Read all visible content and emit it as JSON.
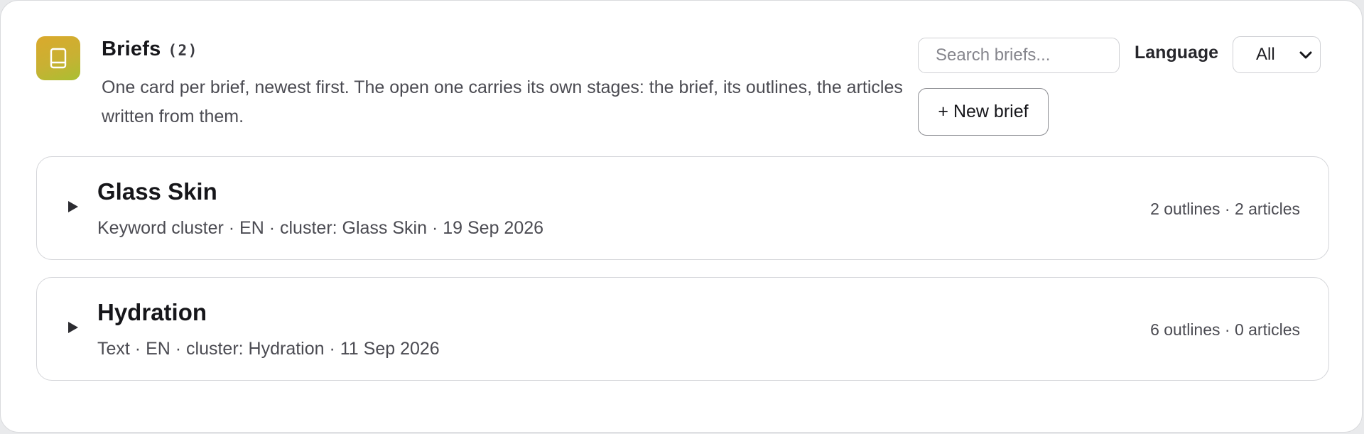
{
  "header": {
    "title": "Briefs",
    "count": "(2)",
    "subtitle": "One card per brief, newest first. The open one carries its own stages: the brief, its outlines, the articles written from them.",
    "icon": "book-icon",
    "accent_gradient": [
      "#dba92c",
      "#a9bf32"
    ]
  },
  "search": {
    "placeholder": "Search briefs...",
    "value": ""
  },
  "language_filter": {
    "label": "Language",
    "selected": "All"
  },
  "new_brief": {
    "label": "+ New brief"
  },
  "briefs": [
    {
      "name": "Glass Skin",
      "meta": "Keyword cluster · EN · cluster: Glass Skin · 19 Sep 2026",
      "stats": "2 outlines · 2 articles"
    },
    {
      "name": "Hydration",
      "meta": "Text · EN · cluster: Hydration · 11 Sep 2026",
      "stats": "6 outlines · 0 articles"
    }
  ]
}
